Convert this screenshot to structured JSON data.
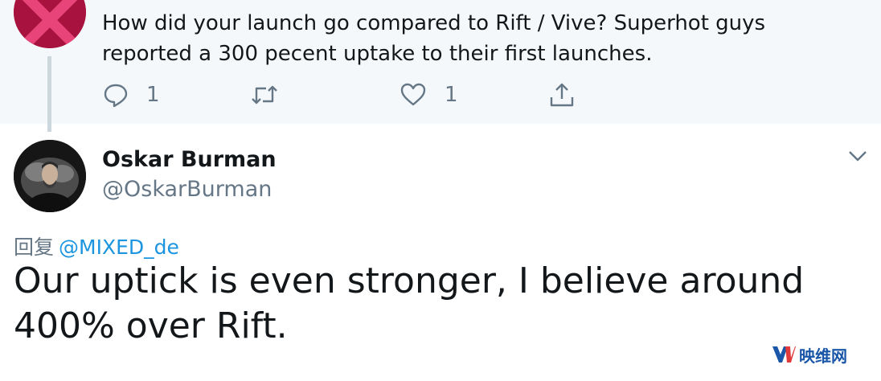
{
  "parent_tweet": {
    "cut_top_text": "— ‾ ‾ ‾ — ‾ ‾ ‾ —",
    "text": "How did your launch go compared to Rift / Vive? Superhot guys reported a 300 pecent uptake to their first launches.",
    "actions": {
      "reply_count": "1",
      "retweet_count": "",
      "like_count": "1"
    }
  },
  "reply_tweet": {
    "author_name": "Oskar Burman",
    "author_handle": "@OskarBurman",
    "reply_prefix": "回复",
    "reply_mention": "@MIXED_de",
    "text": "Our uptick is even stronger, I believe around 400% over Rift."
  },
  "watermark": {
    "text": "映维网"
  },
  "colors": {
    "parent_bg": "#f5f8fa",
    "secondary_text": "#657786",
    "link": "#1b95e0",
    "thread_line": "#ccd6dd"
  }
}
